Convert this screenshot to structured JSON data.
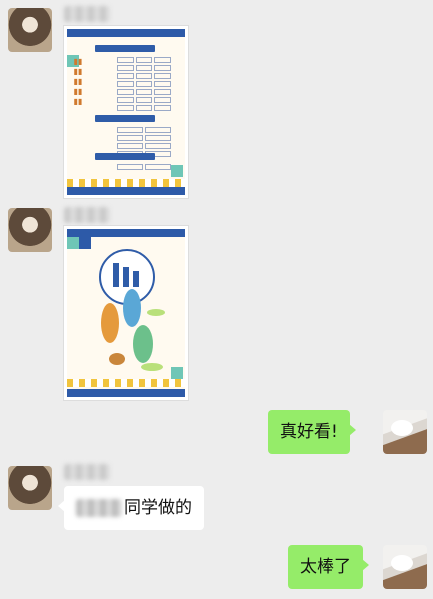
{
  "messages": {
    "reply_1": "真好看!",
    "reply_2": "太棒了",
    "received_text": "同学做的"
  },
  "colors": {
    "outgoing_bubble": "#95ec69",
    "incoming_bubble": "#ffffff",
    "background": "#ededed"
  },
  "icons": {
    "avatar_left": "user-avatar",
    "avatar_right": "cat-avatar"
  }
}
